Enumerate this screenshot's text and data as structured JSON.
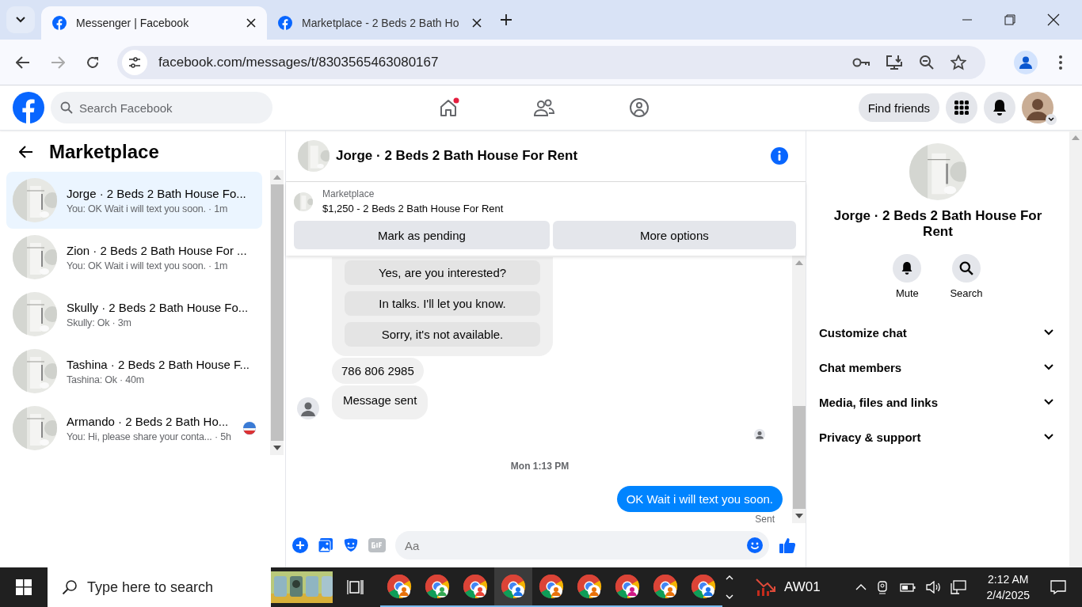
{
  "browser": {
    "tabs": [
      {
        "title": "Messenger | Facebook",
        "selected": true
      },
      {
        "title": "Marketplace - 2 Beds 2 Bath Ho",
        "selected": false
      }
    ],
    "url": "facebook.com/messages/t/8303565463080167"
  },
  "header": {
    "search": {
      "placeholder": "Search Facebook"
    },
    "find_friends": "Find friends"
  },
  "sidebar": {
    "title": "Marketplace",
    "conversations": [
      {
        "name": "Jorge · 2 Beds 2 Bath House Fo...",
        "preview": "You: OK Wait i will text you soon. · 1m",
        "selected": true,
        "read_avatar": false
      },
      {
        "name": "Zion · 2 Beds 2 Bath House For ...",
        "preview": "You: OK Wait i will text you soon. · 1m",
        "selected": false,
        "read_avatar": false
      },
      {
        "name": "Skully · 2 Beds 2 Bath House Fo...",
        "preview": "Skully: Ok · 3m",
        "selected": false,
        "read_avatar": false
      },
      {
        "name": "Tashina · 2 Beds 2 Bath House F...",
        "preview": "Tashina: Ok · 40m",
        "selected": false,
        "read_avatar": false
      },
      {
        "name": "Armando · 2 Beds 2 Bath Ho...",
        "preview": "You: Hi, please share your conta... · 5h",
        "selected": false,
        "read_avatar": true
      }
    ]
  },
  "chat": {
    "title": "Jorge · 2 Beds 2 Bath House For Rent",
    "listing": {
      "label": "Marketplace",
      "text": "$1,250 - 2 Beds 2 Bath House For Rent"
    },
    "buttons": [
      "Mark as pending",
      "More options"
    ],
    "messages": [
      {
        "kind": "replies",
        "items": [
          "Yes, are you interested?",
          "In talks. I'll let you know.",
          "Sorry, it's not available."
        ]
      },
      {
        "kind": "incoming",
        "text": "786 806 2985",
        "avatar": false
      },
      {
        "kind": "incoming",
        "text": "Message sent",
        "avatar": true
      },
      {
        "kind": "seen"
      },
      {
        "kind": "timestamp",
        "text": "Mon 1:13 PM"
      },
      {
        "kind": "outgoing",
        "text": "OK Wait i will text you soon.",
        "status": "Sent"
      }
    ],
    "composer": {
      "placeholder": "Aa"
    }
  },
  "details": {
    "title": "Jorge · 2 Beds 2 Bath House For Rent",
    "actions": [
      {
        "kind": "mute",
        "label": "Mute"
      },
      {
        "kind": "search",
        "label": "Search"
      }
    ],
    "sections": [
      "Customize chat",
      "Chat members",
      "Media, files and links",
      "Privacy & support"
    ]
  },
  "taskbar": {
    "search": {
      "placeholder": "Type here to search"
    },
    "app_label": "AW01",
    "time": "2:12 AM",
    "date": "2/4/2025"
  }
}
